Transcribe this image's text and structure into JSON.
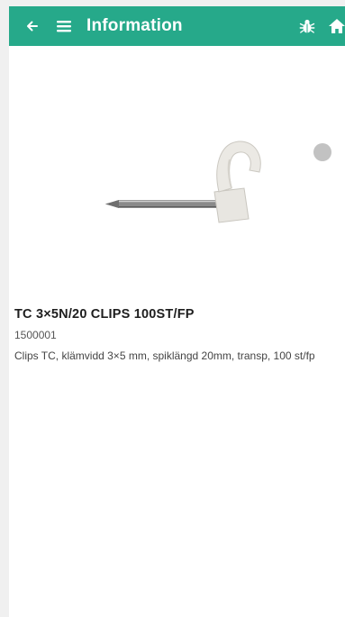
{
  "colors": {
    "header_background": "#26a98a",
    "header_text": "#ffffff",
    "page_background": "#ffffff"
  },
  "header": {
    "back_icon": "arrow-left-icon",
    "menu_icon": "hamburger-menu-icon",
    "title": "Information",
    "bug_icon": "bug-icon",
    "home_icon": "home-icon"
  },
  "product": {
    "image": "cable-clip-image",
    "name": "TC 3×5N/20 CLIPS 100ST/FP",
    "number": "1500001",
    "description": "Clips TC, klämvidd 3×5 mm, spiklängd 20mm, transp, 100 st/fp"
  }
}
